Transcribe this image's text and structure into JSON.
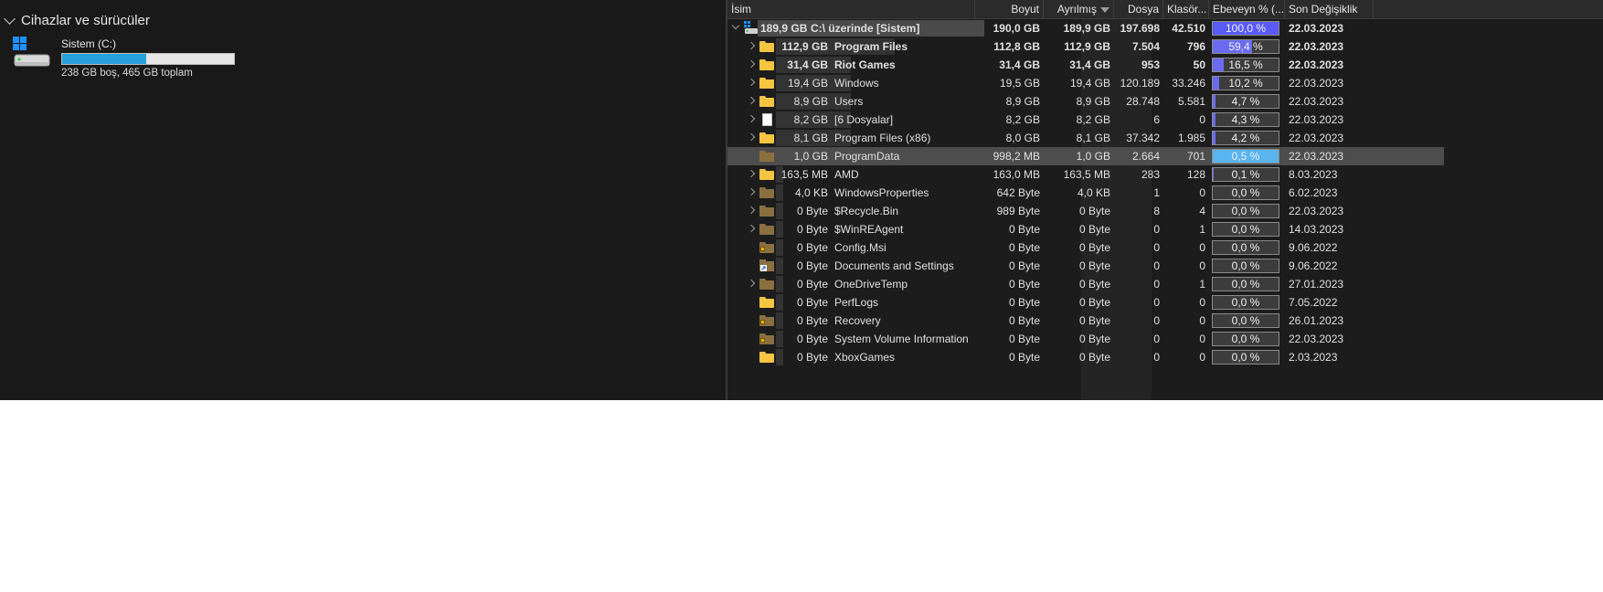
{
  "left_pane": {
    "section_title": "Cihazlar ve sürücüler",
    "drive": {
      "name": "Sistem (C:)",
      "space_text": "238 GB boş, 465 GB toplam",
      "usage_fraction": 0.49,
      "usage_color": "#26a0da"
    }
  },
  "tree": {
    "columns": {
      "name": "İsim",
      "size": "Boyut",
      "allocated": "Ayrılmış",
      "files": "Dosya",
      "folders": "Klasör...",
      "percent": "Ebeveyn % (...",
      "modified": "Son Değişiklik"
    },
    "colors": {
      "percent_fill": "#6b6bf0",
      "percent_fill_root": "#5a5af5",
      "percent_fill_selected": "#5ab4f0",
      "folder": "#f5c542",
      "folder_special": "#8a7040",
      "selected_row": "#4d4d4d"
    },
    "rows": [
      {
        "level": 0,
        "expander": "open",
        "icon": "drive-icon",
        "bold": true,
        "alloc_label": "189,9 GB",
        "name": "C:\\ üzerinde  [Sistem]",
        "size": "190,0 GB",
        "allocated": "189,9 GB",
        "files": "197.698",
        "folders": "42.510",
        "percent": "100,0 %",
        "pct": 1.0,
        "modified": "22.03.2023"
      },
      {
        "level": 1,
        "expander": "closed",
        "icon": "folder-icon",
        "bold": true,
        "alloc_label": "112,9 GB",
        "name": "Program Files",
        "size": "112,8 GB",
        "allocated": "112,9 GB",
        "files": "7.504",
        "folders": "796",
        "percent": "59,4 %",
        "pct": 0.594,
        "modified": "22.03.2023"
      },
      {
        "level": 1,
        "expander": "closed",
        "icon": "folder-icon",
        "bold": true,
        "alloc_label": "31,4 GB",
        "name": "Riot Games",
        "size": "31,4 GB",
        "allocated": "31,4 GB",
        "files": "953",
        "folders": "50",
        "percent": "16,5 %",
        "pct": 0.165,
        "modified": "22.03.2023"
      },
      {
        "level": 1,
        "expander": "closed",
        "icon": "folder-icon",
        "bold": false,
        "alloc_label": "19,4 GB",
        "name": "Windows",
        "size": "19,5 GB",
        "allocated": "19,4 GB",
        "files": "120.189",
        "folders": "33.246",
        "percent": "10,2 %",
        "pct": 0.102,
        "modified": "22.03.2023"
      },
      {
        "level": 1,
        "expander": "closed",
        "icon": "folder-icon",
        "bold": false,
        "alloc_label": "8,9 GB",
        "name": "Users",
        "size": "8,9 GB",
        "allocated": "8,9 GB",
        "files": "28.748",
        "folders": "5.581",
        "percent": "4,7 %",
        "pct": 0.047,
        "modified": "22.03.2023"
      },
      {
        "level": 1,
        "expander": "closed",
        "icon": "file-icon",
        "bold": false,
        "alloc_label": "8,2 GB",
        "name": "[6 Dosyalar]",
        "size": "8,2 GB",
        "allocated": "8,2 GB",
        "files": "6",
        "folders": "0",
        "percent": "4,3 %",
        "pct": 0.043,
        "modified": "22.03.2023"
      },
      {
        "level": 1,
        "expander": "closed",
        "icon": "folder-icon",
        "bold": false,
        "alloc_label": "8,1 GB",
        "name": "Program Files (x86)",
        "size": "8,0 GB",
        "allocated": "8,1 GB",
        "files": "37.342",
        "folders": "1.985",
        "percent": "4,2 %",
        "pct": 0.042,
        "modified": "22.03.2023"
      },
      {
        "level": 1,
        "expander": "none",
        "icon": "folder-hidden-icon",
        "bold": false,
        "selected": true,
        "alloc_label": "1,0 GB",
        "name": "ProgramData",
        "size": "998,2 MB",
        "allocated": "1,0 GB",
        "files": "2.664",
        "folders": "701",
        "percent": "0,5 %",
        "pct": 0.005,
        "modified": "22.03.2023"
      },
      {
        "level": 1,
        "expander": "closed",
        "icon": "folder-icon",
        "bold": false,
        "alloc_label": "163,5 MB",
        "name": "AMD",
        "size": "163,0 MB",
        "allocated": "163,5 MB",
        "files": "283",
        "folders": "128",
        "percent": "0,1 %",
        "pct": 0.001,
        "modified": "8.03.2023"
      },
      {
        "level": 1,
        "expander": "closed",
        "icon": "folder-hidden-icon",
        "bold": false,
        "alloc_label": "4,0 KB",
        "name": "WindowsProperties",
        "size": "642 Byte",
        "allocated": "4,0 KB",
        "files": "1",
        "folders": "0",
        "percent": "0,0 %",
        "pct": 0,
        "modified": "6.02.2023"
      },
      {
        "level": 1,
        "expander": "closed",
        "icon": "folder-hidden-icon",
        "bold": false,
        "alloc_label": "0 Byte",
        "name": "$Recycle.Bin",
        "size": "989 Byte",
        "allocated": "0 Byte",
        "files": "8",
        "folders": "4",
        "percent": "0,0 %",
        "pct": 0,
        "modified": "22.03.2023"
      },
      {
        "level": 1,
        "expander": "closed",
        "icon": "folder-hidden-icon",
        "bold": false,
        "alloc_label": "0 Byte",
        "name": "$WinREAgent",
        "size": "0 Byte",
        "allocated": "0 Byte",
        "files": "0",
        "folders": "1",
        "percent": "0,0 %",
        "pct": 0,
        "modified": "14.03.2023"
      },
      {
        "level": 1,
        "expander": "none",
        "icon": "folder-locked-icon",
        "bold": false,
        "alloc_label": "0 Byte",
        "name": "Config.Msi",
        "size": "0 Byte",
        "allocated": "0 Byte",
        "files": "0",
        "folders": "0",
        "percent": "0,0 %",
        "pct": 0,
        "modified": "9.06.2022"
      },
      {
        "level": 1,
        "expander": "none",
        "icon": "shortcut-icon",
        "bold": false,
        "alloc_label": "0 Byte",
        "name": "Documents and Settings",
        "size": "0 Byte",
        "allocated": "0 Byte",
        "files": "0",
        "folders": "0",
        "percent": "0,0 %",
        "pct": 0,
        "modified": "9.06.2022"
      },
      {
        "level": 1,
        "expander": "closed",
        "icon": "folder-hidden-icon",
        "bold": false,
        "alloc_label": "0 Byte",
        "name": "OneDriveTemp",
        "size": "0 Byte",
        "allocated": "0 Byte",
        "files": "0",
        "folders": "1",
        "percent": "0,0 %",
        "pct": 0,
        "modified": "27.01.2023"
      },
      {
        "level": 1,
        "expander": "none",
        "icon": "folder-icon",
        "bold": false,
        "alloc_label": "0 Byte",
        "name": "PerfLogs",
        "size": "0 Byte",
        "allocated": "0 Byte",
        "files": "0",
        "folders": "0",
        "percent": "0,0 %",
        "pct": 0,
        "modified": "7.05.2022"
      },
      {
        "level": 1,
        "expander": "none",
        "icon": "folder-locked-icon",
        "bold": false,
        "alloc_label": "0 Byte",
        "name": "Recovery",
        "size": "0 Byte",
        "allocated": "0 Byte",
        "files": "0",
        "folders": "0",
        "percent": "0,0 %",
        "pct": 0,
        "modified": "26.01.2023"
      },
      {
        "level": 1,
        "expander": "none",
        "icon": "folder-locked-icon",
        "bold": false,
        "alloc_label": "0 Byte",
        "name": "System Volume Information",
        "size": "0 Byte",
        "allocated": "0 Byte",
        "files": "0",
        "folders": "0",
        "percent": "0,0 %",
        "pct": 0,
        "modified": "22.03.2023"
      },
      {
        "level": 1,
        "expander": "none",
        "icon": "folder-icon",
        "bold": false,
        "alloc_label": "0 Byte",
        "name": "XboxGames",
        "size": "0 Byte",
        "allocated": "0 Byte",
        "files": "0",
        "folders": "0",
        "percent": "0,0 %",
        "pct": 0,
        "modified": "2.03.2023"
      }
    ]
  }
}
